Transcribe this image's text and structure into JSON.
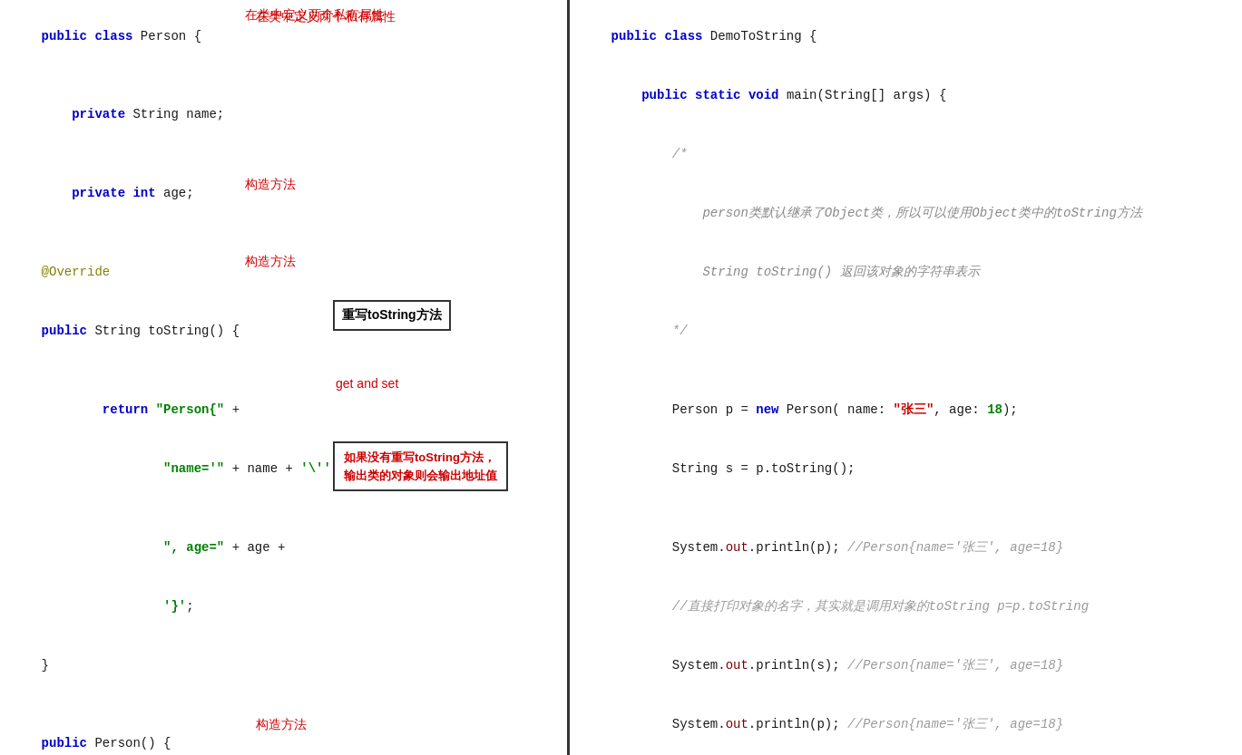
{
  "left_panel": {
    "lines": []
  },
  "right_panel": {
    "lines": []
  },
  "labels": {
    "private_attrs": "在类中定义两个私有属性",
    "override_toString": "重写toString方法",
    "warning_toString": "如果没有重写toString方法，\n输出类的对象则会输出地址值",
    "constructor_label1": "构造方法",
    "constructor_label2": "构造方法",
    "get_set_label": "get and set"
  }
}
